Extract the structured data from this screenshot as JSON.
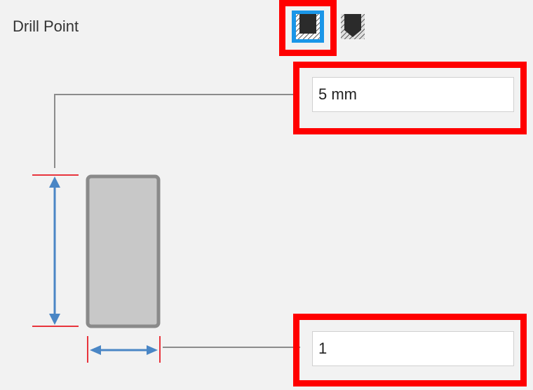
{
  "drill_point": {
    "label": "Drill Point",
    "options": [
      {
        "name": "flat-drill-point",
        "selected": true
      },
      {
        "name": "angled-drill-point",
        "selected": false
      }
    ]
  },
  "depth_field": {
    "value": "5 mm"
  },
  "width_field": {
    "value": "1"
  },
  "colors": {
    "selected_accent": "#1a96e8",
    "highlight": "#ff0000",
    "dimension_arrow": "#4a86c5",
    "dimension_limit": "#e8343c",
    "hole_fill": "#c8c8c8",
    "hole_border": "#8a8a8a"
  }
}
